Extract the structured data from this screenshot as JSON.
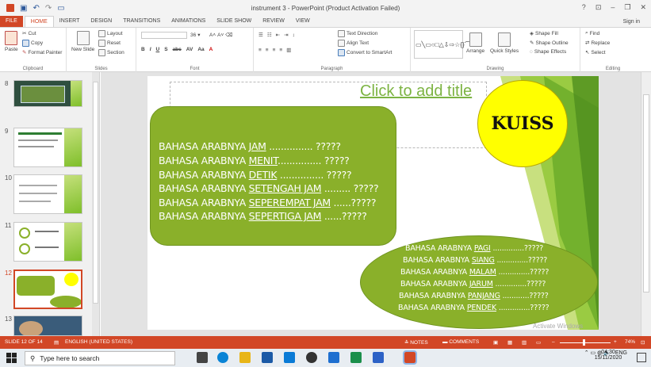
{
  "titlebar": {
    "title": "instrument 3 - PowerPoint (Product Activation Failed)",
    "help": "?",
    "restore": "⊡",
    "minimize": "–",
    "maximize": "❐",
    "close": "✕"
  },
  "tabs": [
    {
      "label": "FILE"
    },
    {
      "label": "HOME"
    },
    {
      "label": "INSERT"
    },
    {
      "label": "DESIGN"
    },
    {
      "label": "TRANSITIONS"
    },
    {
      "label": "ANIMATIONS"
    },
    {
      "label": "SLIDE SHOW"
    },
    {
      "label": "REVIEW"
    },
    {
      "label": "VIEW"
    }
  ],
  "sign_in": "Sign in",
  "ribbon": {
    "clipboard": {
      "paste": "Paste",
      "cut": "Cut",
      "copy": "Copy",
      "format_painter": "Format Painter",
      "label": "Clipboard"
    },
    "slides": {
      "new_slide": "New Slide",
      "layout": "Layout",
      "reset": "Reset",
      "section": "Section",
      "label": "Slides"
    },
    "font": {
      "size": "36",
      "label": "Font"
    },
    "paragraph": {
      "text_direction": "Text Direction",
      "align_text": "Align Text",
      "convert_smartart": "Convert to SmartArt",
      "label": "Paragraph"
    },
    "drawing": {
      "arrange": "Arrange",
      "quick_styles": "Quick Styles",
      "shape_fill": "Shape Fill",
      "shape_outline": "Shape Outline",
      "shape_effects": "Shape Effects",
      "label": "Drawing"
    },
    "editing": {
      "find": "Find",
      "replace": "Replace",
      "select": "Select",
      "label": "Editing"
    }
  },
  "thumbnails": [
    {
      "num": "8"
    },
    {
      "num": "9"
    },
    {
      "num": "10"
    },
    {
      "num": "11"
    },
    {
      "num": "12"
    },
    {
      "num": "13"
    }
  ],
  "slide": {
    "title_placeholder": "Click to add title",
    "kuis": "KUISS",
    "box1": [
      {
        "pre": "BAHASA ARABNYA ",
        "word": "JAM",
        "post": " ............... ?????"
      },
      {
        "pre": "BAHASA ARABNYA ",
        "word": "MENIT",
        "post": "............... ?????"
      },
      {
        "pre": "BAHASA ARABNYA ",
        "word": "DETIK",
        "post": " ............... ?????"
      },
      {
        "pre": "BAHASA ARABNYA ",
        "word": "SETENGAH JAM",
        "post": " ......... ?????"
      },
      {
        "pre": "BAHASA ARABNYA ",
        "word": "SEPEREMPAT JAM",
        "post": " ......?????"
      },
      {
        "pre": "BAHASA ARABNYA ",
        "word": "SEPERTIGA JAM",
        "post": " ......?????"
      }
    ],
    "box2": [
      {
        "pre": "BAHASA ARABNYA ",
        "word": "PAGI",
        "post": " ..............?????"
      },
      {
        "pre": "BAHASA ARABNYA ",
        "word": "SIANG",
        "post": " ..............?????"
      },
      {
        "pre": "BAHASA ARABNYA ",
        "word": "MALAM",
        "post": " ..............?????"
      },
      {
        "pre": "BAHASA ARABNYA ",
        "word": "JARUM",
        "post": " ..............?????"
      },
      {
        "pre": "BAHASA ARABNYA ",
        "word": "PANJANG",
        "post": " ............?????"
      },
      {
        "pre": "BAHASA ARABNYA ",
        "word": "PENDEK",
        "post": " ..............?????"
      }
    ],
    "watermark": "Activate Windows"
  },
  "statusbar": {
    "slide_info": "SLIDE 12 OF 14",
    "language": "ENGLISH (UNITED STATES)",
    "notes": "NOTES",
    "comments": "COMMENTS",
    "zoom": "74%"
  },
  "taskbar": {
    "search_placeholder": "Type here to search",
    "lang": "ENG",
    "time": "04:30",
    "date": "15/11/2020"
  },
  "colors": {
    "accent": "#d24726",
    "slide_green": "#8ab02a",
    "kuis_yellow": "#ffff00",
    "title_green": "#7cb342"
  }
}
